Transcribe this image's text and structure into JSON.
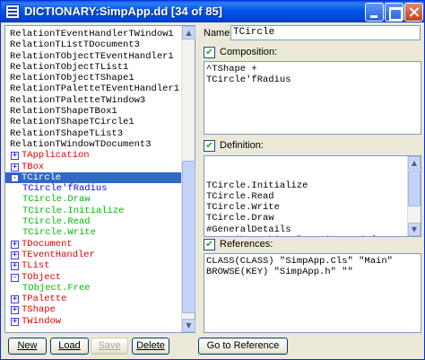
{
  "window": {
    "title": "DICTIONARY:SimpApp.dd [34 of 85]",
    "icon": "app-icon"
  },
  "tree": {
    "items": [
      {
        "text": "RelationTEventHandlerTWindow1",
        "color": "black",
        "toggle": null,
        "indent": false
      },
      {
        "text": "RelationTListTDocument3",
        "color": "black",
        "toggle": null,
        "indent": false
      },
      {
        "text": "RelationTObjectTEventHandler1",
        "color": "black",
        "toggle": null,
        "indent": false
      },
      {
        "text": "RelationTObjectTList1",
        "color": "black",
        "toggle": null,
        "indent": false
      },
      {
        "text": "RelationTObjectTShape1",
        "color": "black",
        "toggle": null,
        "indent": false
      },
      {
        "text": "RelationTPaletteTEventHandler1",
        "color": "black",
        "toggle": null,
        "indent": false
      },
      {
        "text": "RelationTPaletteTWindow3",
        "color": "black",
        "toggle": null,
        "indent": false
      },
      {
        "text": "RelationTShapeTBox1",
        "color": "black",
        "toggle": null,
        "indent": false
      },
      {
        "text": "RelationTShapeTCircle1",
        "color": "black",
        "toggle": null,
        "indent": false
      },
      {
        "text": "RelationTShapeTList3",
        "color": "black",
        "toggle": null,
        "indent": false
      },
      {
        "text": "RelationTWindowTDocument3",
        "color": "black",
        "toggle": null,
        "indent": false
      },
      {
        "text": "TApplication",
        "color": "red",
        "toggle": "+",
        "indent": false
      },
      {
        "text": "TBox",
        "color": "red",
        "toggle": "+",
        "indent": false
      },
      {
        "text": "TCircle",
        "color": "red",
        "toggle": "-",
        "indent": false,
        "selected": true
      },
      {
        "text": "TCircle'fRadius",
        "color": "blue",
        "toggle": null,
        "indent": true
      },
      {
        "text": "TCircle.Draw",
        "color": "green",
        "toggle": null,
        "indent": true
      },
      {
        "text": "TCircle.Initialize",
        "color": "green",
        "toggle": null,
        "indent": true
      },
      {
        "text": "TCircle.Read",
        "color": "green",
        "toggle": null,
        "indent": true
      },
      {
        "text": "TCircle.Write",
        "color": "green",
        "toggle": null,
        "indent": true
      },
      {
        "text": "TDocument",
        "color": "red",
        "toggle": "+",
        "indent": false
      },
      {
        "text": "TEventHandler",
        "color": "red",
        "toggle": "+",
        "indent": false
      },
      {
        "text": "TList",
        "color": "red",
        "toggle": "+",
        "indent": false
      },
      {
        "text": "TObject",
        "color": "red",
        "toggle": "-",
        "indent": false
      },
      {
        "text": "TObject.Free",
        "color": "green",
        "toggle": null,
        "indent": true
      },
      {
        "text": "TPalette",
        "color": "red",
        "toggle": "+",
        "indent": false
      },
      {
        "text": "TShape",
        "color": "red",
        "toggle": "+",
        "indent": false
      },
      {
        "text": "TWindow",
        "color": "red",
        "toggle": "+",
        "indent": false
      }
    ]
  },
  "name": {
    "label": "Name:",
    "value": "TCircle"
  },
  "composition": {
    "label": "Composition:",
    "checked": true,
    "text": "^TShape +\nTCircle'fRadius"
  },
  "definition": {
    "label": "Definition:",
    "checked": true,
    "text": "TCircle.Initialize\nTCircle.Read\nTCircle.Write\nTCircle.Draw\n#GeneralDetails\nDescribe: this class is used for\ncircular shapes"
  },
  "references": {
    "label": "References:",
    "checked": true,
    "text": "CLASS(CLASS) \"SimpApp.Cls\" \"Main\"\nBROWSE(KEY) \"SimpApp.h\" \"\""
  },
  "buttons": {
    "new": "New",
    "load": "Load",
    "save": "Save",
    "delete": "Delete",
    "goto": "Go to Reference"
  },
  "colors": {
    "red": "#e00000",
    "blue": "#0000ff",
    "green": "#00b800",
    "selection": "#316ac5"
  }
}
